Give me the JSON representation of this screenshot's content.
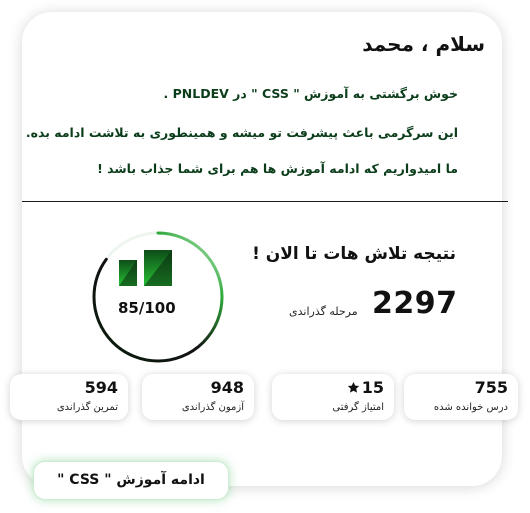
{
  "greeting": "سلام ، محمد",
  "welcome": {
    "line1": "خوش برگشتی به آموزش \" CSS \" در PNLDEV .",
    "line2": "این سرگرمی باعث پیشرفت تو میشه و همینطوری به تلاشت ادامه بده.",
    "line3": "ما امیدواریم که ادامه آموزش ها هم برای شما جذاب باشد !"
  },
  "result": {
    "title": "نتیجه تلاش هات تا الان !",
    "levels_value": "2297",
    "levels_label": "مرحله گذراندی",
    "score_text": "85/100",
    "score_fraction": 0.85
  },
  "stats": [
    {
      "value": "755",
      "label": "درس خوانده شده",
      "icon": null
    },
    {
      "value": "15",
      "label": "امتیاز گرفتی",
      "icon": "star-icon"
    },
    {
      "value": "948",
      "label": "آزمون گذراندی",
      "icon": null
    },
    {
      "value": "594",
      "label": "تمرین گذراندی",
      "icon": null
    }
  ],
  "cta": {
    "label": "ادامه آموزش \" CSS \""
  },
  "colors": {
    "accent": "#1f8f2a",
    "accent_light": "#3ed54a",
    "text": "#111111",
    "welcome_text": "#0b3d1b"
  }
}
